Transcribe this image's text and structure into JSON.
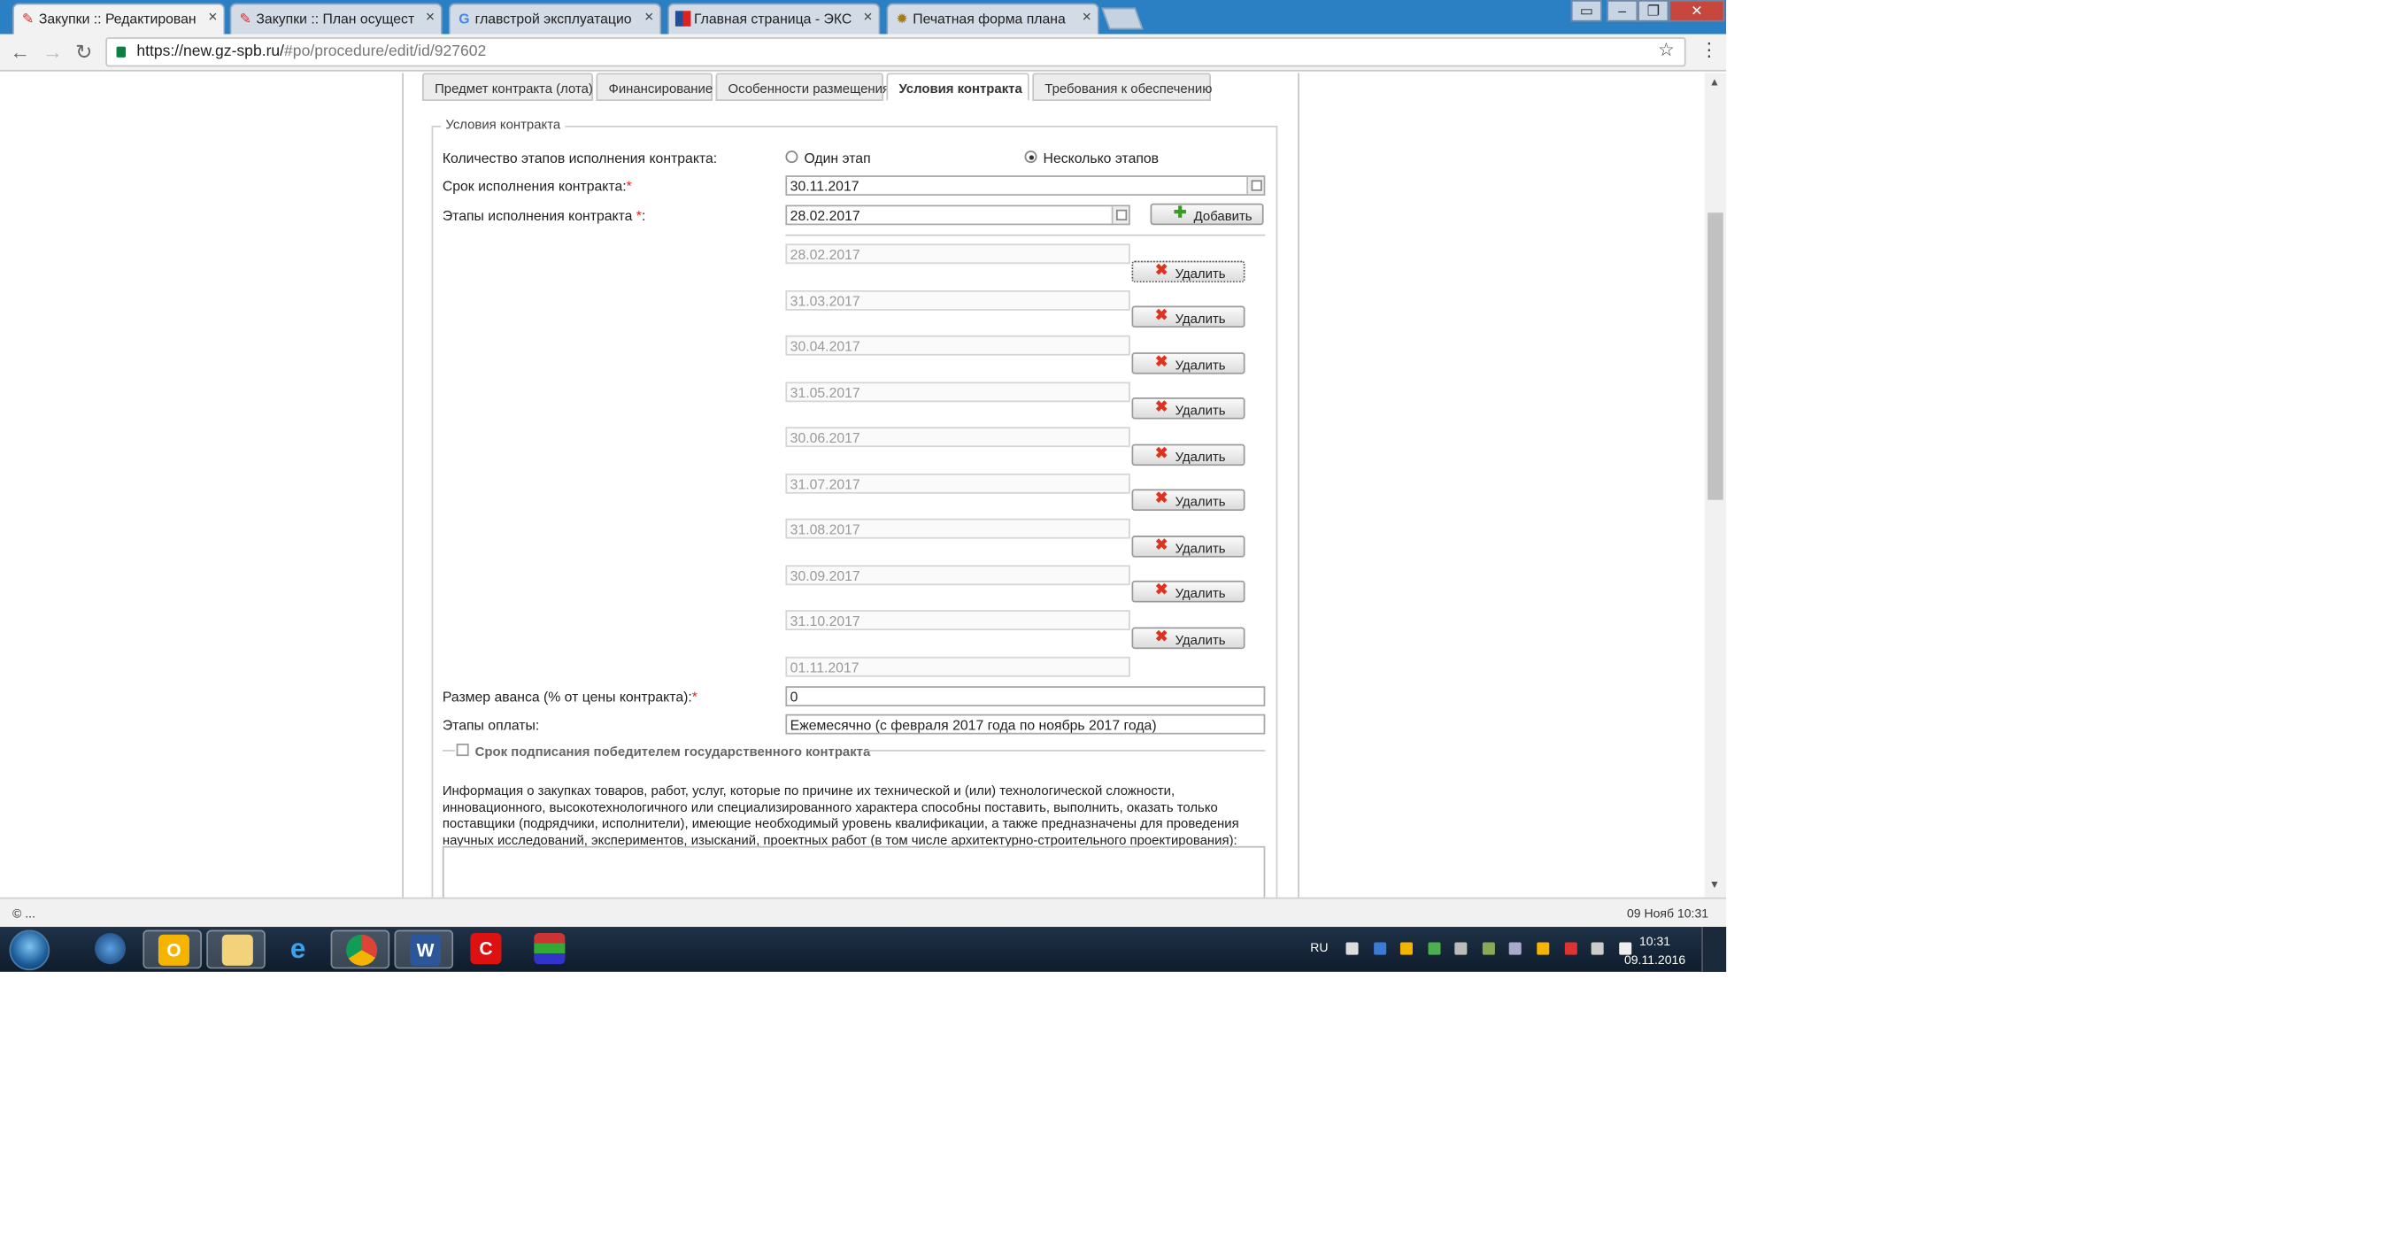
{
  "browser": {
    "tabs": [
      {
        "title": "Закупки :: Редактирован",
        "icon": "gz-app-icon",
        "active": true
      },
      {
        "title": "Закупки :: План осущест",
        "icon": "gz-app-icon",
        "active": false
      },
      {
        "title": "главстрой эксплуатацио",
        "icon": "google-g-icon",
        "active": false
      },
      {
        "title": "Главная страница - ЭКС",
        "icon": "eks-flag-icon",
        "active": false
      },
      {
        "title": "Печатная форма плана",
        "icon": "emblem-icon",
        "active": false
      }
    ],
    "tab_close_glyph": "×",
    "url_host": "https://new.gz-spb.ru/",
    "url_path": "#po/procedure/edit/id/927602"
  },
  "form": {
    "tabs": [
      "Предмет контракта (лота)",
      "Финансирование",
      "Особенности размещения",
      "Условия контракта",
      "Требования к обеспечению"
    ],
    "active_tab": "Условия контракта",
    "legend": "Условия контракта",
    "stages_count_label": "Количество этапов исполнения контракта:",
    "radio_one": "Один этап",
    "radio_many": "Несколько этапов",
    "selected_radio": "Несколько этапов",
    "term_label": "Срок исполнения контракта:",
    "term_value": "30.11.2017",
    "stages_label": "Этапы исполнения контракта ",
    "stages_colon": ":",
    "stage_input_value": "28.02.2017",
    "add_button": "Добавить",
    "stage_dates": [
      "28.02.2017",
      "31.03.2017",
      "30.04.2017",
      "31.05.2017",
      "30.06.2017",
      "31.07.2017",
      "31.08.2017",
      "30.09.2017",
      "31.10.2017",
      "01.11.2017"
    ],
    "delete_button": "Удалить",
    "advance_label": "Размер аванса (% от цены контракта):",
    "advance_value": "0",
    "payment_stages_label": "Этапы оплаты:",
    "payment_stages_value": "Ежемесячно (с февраля 2017 года по ноябрь 2017 года)",
    "signing_term_label": "Срок подписания победителем государственного контракта",
    "info_text": "Информация о закупках товаров, работ, услуг, которые по причине их технической и (или) технологической сложности, инновационного, высокотехнологичного или специализированного характера способны поставить, выполнить, оказать только поставщики (подрядчики, исполнители), имеющие необходимый уровень квалификации, а также предназначены для проведения научных исследований, экспериментов, изысканий, проектных работ (в том числе архитектурно-строительного проектирования):",
    "required_mark": "*"
  },
  "statusbar": {
    "left": "© ...",
    "right": "09 Нояб 10:31"
  },
  "taskbar": {
    "apps": [
      "globe-app-icon",
      "outlook-icon",
      "file-explorer-icon",
      "internet-explorer-icon",
      "chrome-icon",
      "word-icon",
      "red-app-icon",
      "colored-app-icon"
    ],
    "language": "RU",
    "time": "10:31",
    "date": "09.11.2016"
  },
  "colors": {
    "titlebar": "#2b7fc3",
    "taskbar": "#0e1c2c",
    "required": "#e02020"
  }
}
